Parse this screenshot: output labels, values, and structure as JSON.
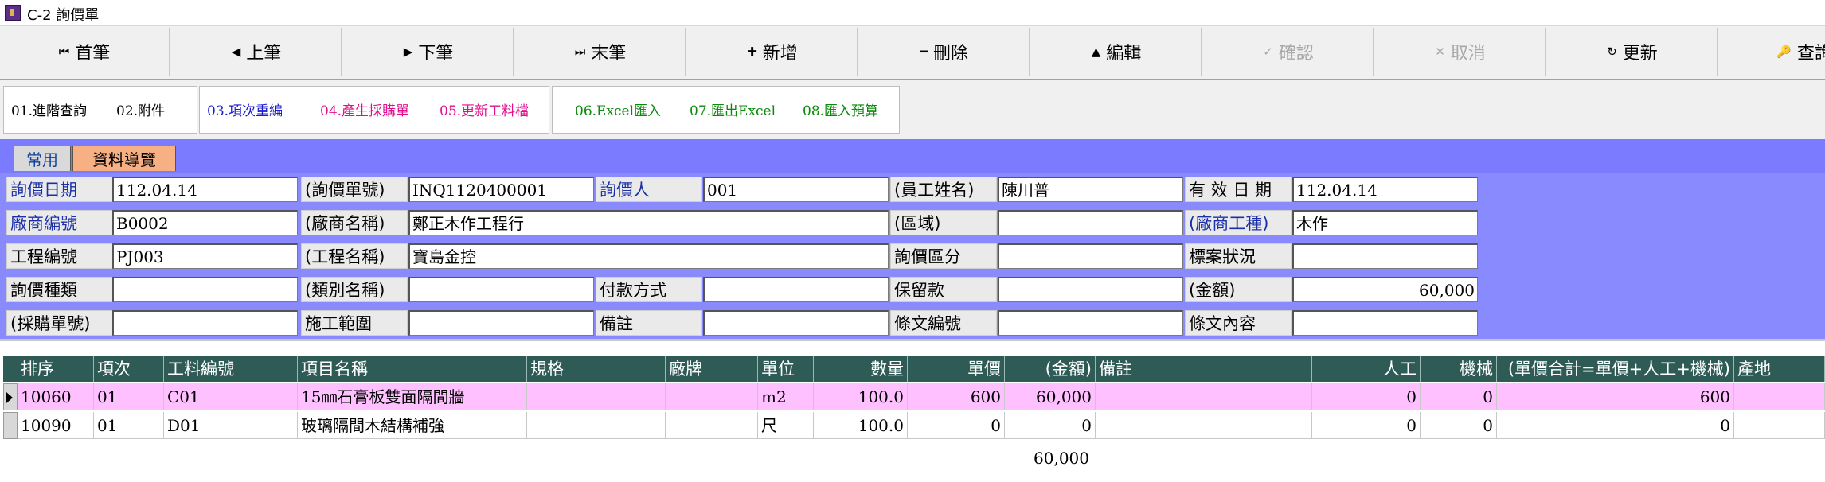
{
  "window": {
    "title": "C-2 詢價單"
  },
  "toolbar": [
    {
      "name": "first-record-button",
      "icon": "skip-first-icon",
      "glyph": "⏮",
      "label": "首筆",
      "disabled": false
    },
    {
      "name": "prev-record-button",
      "icon": "caret-left-icon",
      "glyph": "◀",
      "label": "上筆",
      "disabled": false
    },
    {
      "name": "next-record-button",
      "icon": "caret-right-icon",
      "glyph": "▶",
      "label": "下筆",
      "disabled": false
    },
    {
      "name": "last-record-button",
      "icon": "skip-last-icon",
      "glyph": "⏭",
      "label": "末筆",
      "disabled": false
    },
    {
      "name": "add-button",
      "icon": "plus-icon",
      "glyph": "✚",
      "label": "新增",
      "disabled": false
    },
    {
      "name": "delete-button",
      "icon": "minus-icon",
      "glyph": "━",
      "label": "刪除",
      "disabled": false
    },
    {
      "name": "edit-button",
      "icon": "caret-up-icon",
      "glyph": "▲",
      "label": "編輯",
      "disabled": false
    },
    {
      "name": "confirm-button",
      "icon": "check-icon",
      "glyph": "✓",
      "label": "確認",
      "disabled": true
    },
    {
      "name": "cancel-button",
      "icon": "x-icon",
      "glyph": "✕",
      "label": "取消",
      "disabled": true
    },
    {
      "name": "refresh-button",
      "icon": "refresh-icon",
      "glyph": "↻",
      "label": "更新",
      "disabled": false
    },
    {
      "name": "search-button",
      "icon": "key-icon",
      "glyph": "🔑",
      "label": "查詢",
      "disabled": false
    }
  ],
  "actions": {
    "items": [
      {
        "name": "advanced-query-button",
        "label": "01.進階查詢",
        "color": "#000000"
      },
      {
        "name": "attachments-button",
        "label": "02.附件",
        "color": "#000000"
      },
      {
        "name": "renumber-items-button",
        "label": "03.項次重編",
        "color": "#1a1ac8"
      },
      {
        "name": "generate-po-button",
        "label": "04.產生採購單",
        "color": "#e0108c"
      },
      {
        "name": "update-material-button",
        "label": "05.更新工料檔",
        "color": "#e0108c"
      },
      {
        "name": "excel-import-button",
        "label": "06.Excel匯入",
        "color": "#0a8a0a"
      },
      {
        "name": "excel-export-button",
        "label": "07.匯出Excel",
        "color": "#0a8a0a"
      },
      {
        "name": "import-budget-button",
        "label": "08.匯入預算",
        "color": "#0a8a0a"
      }
    ]
  },
  "tabs": {
    "common": "常用",
    "nav": "資料導覽"
  },
  "form": {
    "labels": {
      "inquiry_date": "詢價日期",
      "inquiry_no": "(詢價單號)",
      "inquirer": "詢價人",
      "employee_name": "(員工姓名)",
      "valid_date": "有 效 日 期",
      "vendor_no": "廠商編號",
      "vendor_name": "(廠商名稱)",
      "region": "(區域)",
      "vendor_trade": "(廠商工種)",
      "project_no": "工程編號",
      "project_name": "(工程名稱)",
      "inquiry_section": "詢價區分",
      "tender_status": "標案狀況",
      "inquiry_type": "詢價種類",
      "type_name": "(類別名稱)",
      "payment_method": "付款方式",
      "retention": "保留款",
      "amount": "(金額)",
      "po_no": "(採購單號)",
      "construction_scope": "施工範圍",
      "remark": "備註",
      "clause_no": "條文編號",
      "clause_content": "條文內容"
    },
    "values": {
      "inquiry_date": "112.04.14",
      "inquiry_no": "INQ1120400001",
      "inquirer": "001",
      "employee_name": "陳川普",
      "valid_date": "112.04.14",
      "vendor_no": "B0002",
      "vendor_name": "鄭正木作工程行",
      "region": "",
      "vendor_trade": "木作",
      "project_no": "PJ003",
      "project_name": "寶島金控",
      "inquiry_section": "",
      "tender_status": "",
      "inquiry_type": "",
      "type_name": "",
      "payment_method": "",
      "retention": "",
      "amount": "60,000",
      "po_no": "",
      "construction_scope": "",
      "remark": "",
      "clause_no": "",
      "clause_content": ""
    }
  },
  "grid": {
    "columns": [
      "排序",
      "項次",
      "工料編號",
      "項目名稱",
      "規格",
      "廠牌",
      "單位",
      "數量",
      "單價",
      "(金額)",
      "備註",
      "人工",
      "機械",
      "(單價合計=單價+人工+機械)",
      "產地"
    ],
    "rows": [
      [
        "10060",
        "01",
        "C01",
        "15㎜石膏板雙面隔間牆",
        "",
        "",
        "m2",
        "100.0",
        "600",
        "60,000",
        "",
        "0",
        "0",
        "600",
        ""
      ],
      [
        "10090",
        "01",
        "D01",
        "玻璃隔間木結構補強",
        "",
        "",
        "尺",
        "100.0",
        "0",
        "0",
        "",
        "0",
        "0",
        "0",
        ""
      ]
    ],
    "total": "60,000",
    "selected_row_color": "#ffc0ff"
  }
}
